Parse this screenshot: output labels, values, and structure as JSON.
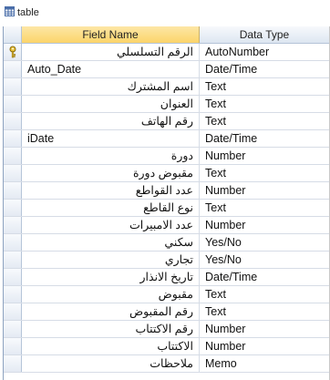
{
  "window": {
    "title": "table"
  },
  "columns": {
    "field_name": "Field Name",
    "data_type": "Data Type"
  },
  "rows": [
    {
      "name": "الرقم التسلسلي",
      "type": "AutoNumber",
      "rtl": true,
      "primary_key": true
    },
    {
      "name": "Auto_Date",
      "type": "Date/Time",
      "rtl": false
    },
    {
      "name": "اسم المشترك",
      "type": "Text",
      "rtl": true
    },
    {
      "name": "العنوان",
      "type": "Text",
      "rtl": true
    },
    {
      "name": "رقم الهاتف",
      "type": "Text",
      "rtl": true
    },
    {
      "name": "iDate",
      "type": "Date/Time",
      "rtl": false
    },
    {
      "name": "دورة",
      "type": "Number",
      "rtl": true
    },
    {
      "name": "مقبوض دورة",
      "type": "Text",
      "rtl": true
    },
    {
      "name": "عدد القواطع",
      "type": "Number",
      "rtl": true
    },
    {
      "name": "نوع القاطع",
      "type": "Text",
      "rtl": true
    },
    {
      "name": "عدد الامبيرات",
      "type": "Number",
      "rtl": true
    },
    {
      "name": "سكني",
      "type": "Yes/No",
      "rtl": true
    },
    {
      "name": "تجاري",
      "type": "Yes/No",
      "rtl": true
    },
    {
      "name": "تاريخ الانذار",
      "type": "Date/Time",
      "rtl": true
    },
    {
      "name": "مقبوض",
      "type": "Text",
      "rtl": true
    },
    {
      "name": "رقم المقبوض",
      "type": "Text",
      "rtl": true
    },
    {
      "name": "رقم الاكتتاب",
      "type": "Number",
      "rtl": true
    },
    {
      "name": "الاكتتاب",
      "type": "Number",
      "rtl": true
    },
    {
      "name": "ملاحظات",
      "type": "Memo",
      "rtl": true
    }
  ],
  "icons": {
    "title": "table-icon",
    "key": "key-icon"
  },
  "colors": {
    "header_selected": "#fbd46a",
    "grid_line": "#d6dce6"
  }
}
